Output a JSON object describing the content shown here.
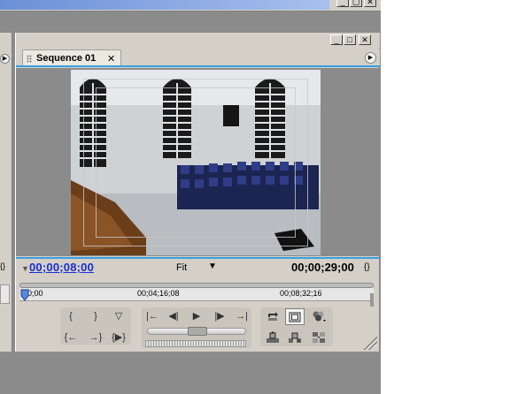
{
  "window": {
    "controls": {
      "minimize": "_",
      "restore": "▢",
      "close": "✕"
    }
  },
  "left_panel": {
    "menu_icon": "panel-menu-arrow",
    "drag_icon": "{}"
  },
  "monitor": {
    "panel_controls": {
      "minimize": "_",
      "maximize": "□",
      "close": "✕"
    },
    "tab": {
      "label": "Sequence 01",
      "close": "✕"
    },
    "current_time": "00;00;08;00",
    "zoom": {
      "value": "Fit",
      "caret": "▼"
    },
    "duration": "00;00;29;00",
    "drag_handle": "{}",
    "ruler": {
      "labels": [
        "00;00",
        "00;04;16;08",
        "00;08;32;16"
      ],
      "playhead_position": 0.0
    },
    "controls": {
      "marker_group": {
        "mark_in": "{",
        "mark_out": "}",
        "set_marker": "▽",
        "go_to_in": "{←",
        "go_to_out": "→}",
        "play_in_to_out": "{▶}"
      },
      "transport": {
        "go_to_previous_edit": "|←",
        "step_back": "◀|",
        "play": "▶",
        "step_forward": "|▶",
        "go_to_next_edit": "→|",
        "jog_level": 0.5
      },
      "right_group": {
        "loop": "loop-icon",
        "safe_margins": "safe-margins-icon",
        "output": "output-icon",
        "lift": "lift-icon",
        "extract": "extract-icon",
        "trim": "trim-icon"
      }
    }
  },
  "colors": {
    "accent_line": "#3aa0e0",
    "timecode": "#1a2fd0",
    "panel_bg": "#d4d0c8",
    "workspace_bg": "#8b8b8b"
  }
}
